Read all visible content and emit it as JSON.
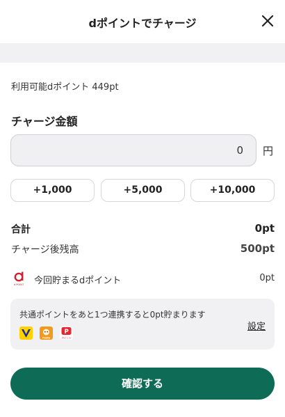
{
  "header": {
    "title": "dポイントでチャージ",
    "close_icon": "close-icon"
  },
  "available": {
    "label": "利用可能dポイント 449pt"
  },
  "charge": {
    "section_title": "チャージ金額",
    "amount_value": "0",
    "currency": "円"
  },
  "quick_add": [
    {
      "label": "+1,000"
    },
    {
      "label": "+5,000"
    },
    {
      "label": "+10,000"
    }
  ],
  "summary": {
    "total_label": "合計",
    "total_value": "0pt",
    "balance_label": "チャージ後残高",
    "balance_value": "500pt"
  },
  "earn": {
    "logo_text": "d POINT",
    "label": "今回貯まるdポイント",
    "value": "0pt"
  },
  "info": {
    "message": "共通ポイントをあと1つ連携すると0pt貯まります",
    "settings_link": "設定",
    "logos": [
      {
        "name": "v-point-logo",
        "color": "#1f2a8a",
        "text": "V"
      },
      {
        "name": "ponta-logo",
        "color": "#f39a1e",
        "text": "Ponta"
      },
      {
        "name": "paypay-point-logo",
        "color": "#e8242e",
        "text": "ポイント"
      }
    ]
  },
  "actions": {
    "confirm_label": "確認する"
  },
  "colors": {
    "accent": "#0e6b56",
    "background_gray": "#f1f1f3",
    "d_red": "#d3202f"
  }
}
